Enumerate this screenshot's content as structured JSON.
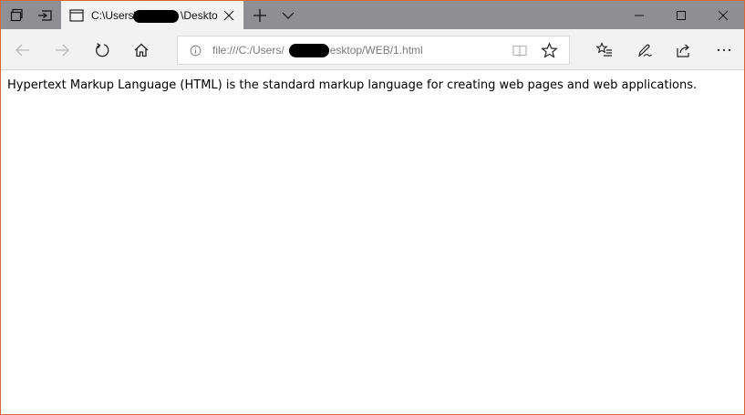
{
  "tab": {
    "title": "C:\\Users\\",
    "title_tail": "\\Deskto"
  },
  "address_bar": {
    "url_start": "file:///C:/Users/",
    "url_end": "/Desktop/WEB/1.html"
  },
  "page": {
    "paragraph": "Hypertext Markup Language (HTML) is the standard markup language for creating web pages and web applications."
  },
  "icons": {
    "tab_actions": "tab-set-aside-icon",
    "tabs_preview": "show-tabs-icon",
    "tab_page": "page-icon",
    "close_tab": "close-icon",
    "new_tab": "plus-icon",
    "tab_list": "chevron-down-icon",
    "minimize": "minimize-icon",
    "maximize": "maximize-icon",
    "close_window": "close-window-icon",
    "back": "back-arrow-icon",
    "forward": "forward-arrow-icon",
    "refresh": "refresh-icon",
    "home": "home-icon",
    "site_info": "info-icon",
    "reading_view": "book-icon",
    "favorite": "star-icon",
    "favorites_hub": "favorites-list-icon",
    "notes": "pen-icon",
    "share": "share-icon",
    "more": "more-icon"
  },
  "colors": {
    "tabbar_bg": "#8e8e93",
    "tab_active_bg": "#f2f2f2",
    "window_border": "#d8683a"
  }
}
